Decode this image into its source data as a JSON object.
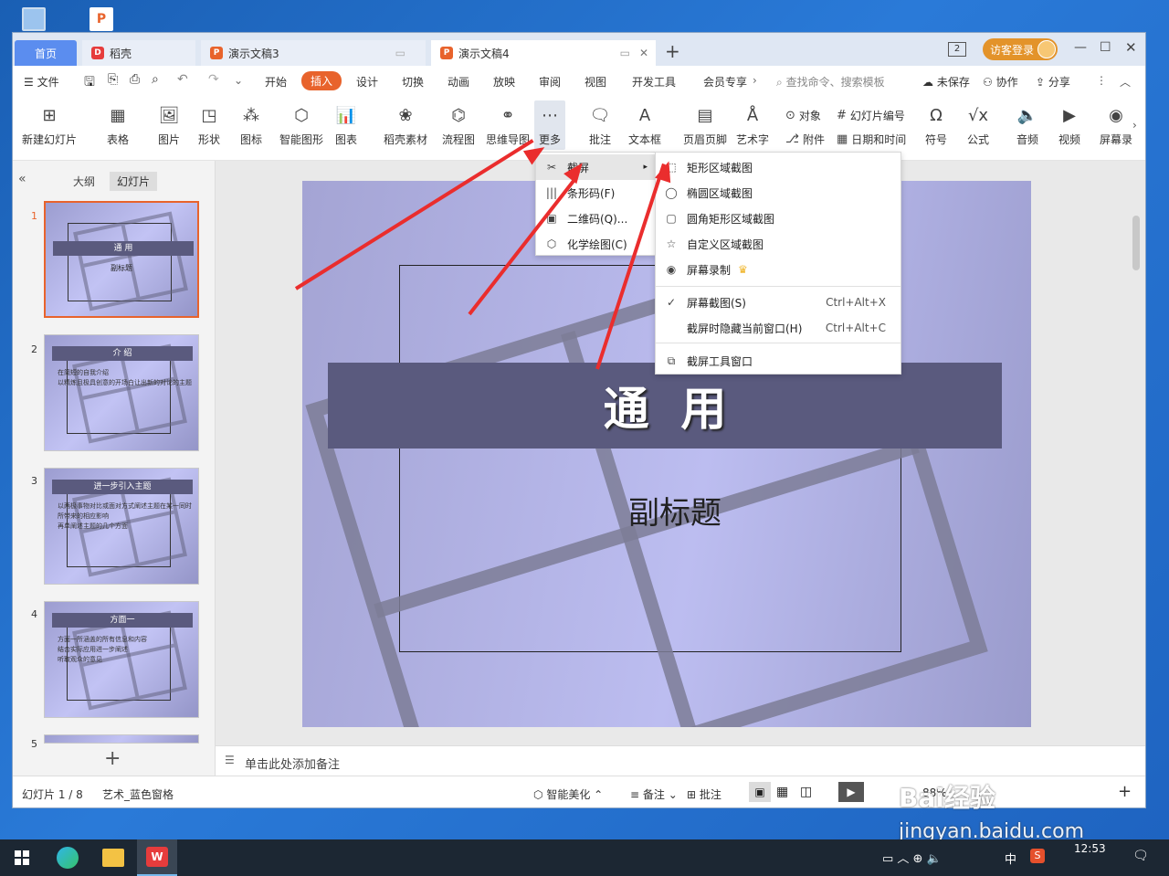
{
  "window": {
    "tabs": [
      {
        "label": "首页"
      },
      {
        "label": "稻壳"
      },
      {
        "label": "演示文稿3"
      },
      {
        "label": "演示文稿4"
      }
    ],
    "page_badge": "2",
    "login": "访客登录"
  },
  "menu": {
    "file": "文件",
    "items": [
      "开始",
      "插入",
      "设计",
      "切换",
      "动画",
      "放映",
      "审阅",
      "视图",
      "开发工具",
      "会员专享"
    ],
    "search_placeholder": "查找命令、搜索模板",
    "unsaved": "未保存",
    "collab": "协作",
    "share": "分享"
  },
  "ribbon": {
    "new_slide": "新建幻灯片",
    "table": "表格",
    "picture": "图片",
    "shape": "形状",
    "icon": "图标",
    "smart_shape": "智能图形",
    "chart": "图表",
    "dk_material": "稻壳素材",
    "flowchart": "流程图",
    "mindmap": "思维导图",
    "more": "更多",
    "comment": "批注",
    "textbox": "文本框",
    "header_footer": "页眉页脚",
    "wordart": "艺术字",
    "object": "对象",
    "attachment": "附件",
    "slide_number": "幻灯片编号",
    "datetime": "日期和时间",
    "symbol": "符号",
    "formula": "公式",
    "audio": "音频",
    "video": "视频",
    "screen_rec": "屏幕录"
  },
  "panel": {
    "outline_tab": "大纲",
    "slides_tab": "幻灯片",
    "slides": [
      {
        "num": "1",
        "title": "通  用",
        "sub": "副标题",
        "bullets": []
      },
      {
        "num": "2",
        "title": "介  绍",
        "bullets": [
          "在简短的自我介绍",
          "以精炼且极具创意的开场白让出新的对论的主题"
        ]
      },
      {
        "num": "3",
        "title": "进一步引入主题",
        "bullets": [
          "以两极事物对比或面对方式阐述主题在某一同时所带来的相应影响",
          "再单阐述主题的几个方面"
        ]
      },
      {
        "num": "4",
        "title": "方面一",
        "bullets": [
          "方面一所涵盖的所有信息和内容",
          "结合实际应用进一步阐述",
          "听取观众的意见"
        ]
      },
      {
        "num": "5"
      }
    ]
  },
  "slide": {
    "title": "通  用",
    "subtitle": "副标题"
  },
  "notes_placeholder": "单击此处添加备注",
  "status": {
    "slide_count": "幻灯片 1 / 8",
    "theme": "艺术_蓝色窗格",
    "beautify": "智能美化",
    "notes": "备注",
    "comment": "批注",
    "zoom": "88%"
  },
  "more_menu": [
    {
      "icon": "scissors-icon",
      "label": "截屏"
    },
    {
      "icon": "barcode-icon",
      "label": "条形码(F)"
    },
    {
      "icon": "qrcode-icon",
      "label": "二维码(Q)..."
    },
    {
      "icon": "chem-icon",
      "label": "化学绘图(C)"
    }
  ],
  "screenshot_menu": [
    {
      "label": "矩形区域截图"
    },
    {
      "label": "椭圆区域截图"
    },
    {
      "label": "圆角矩形区域截图"
    },
    {
      "label": "自定义区域截图"
    },
    {
      "label": "屏幕录制"
    },
    {
      "label": "屏幕截图(S)",
      "shortcut": "Ctrl+Alt+X",
      "checked": true
    },
    {
      "label": "截屏时隐藏当前窗口(H)",
      "shortcut": "Ctrl+Alt+C"
    },
    {
      "label": "截屏工具窗口"
    }
  ],
  "taskbar": {
    "time": "12:53",
    "ime": "中"
  },
  "watermark": {
    "brand": "Bai经验",
    "url": "jingyan.baidu.com"
  },
  "colors": {
    "accent": "#e8632c",
    "tab_active": "#5b8def",
    "arrow": "#ea2d2d",
    "slide_band": "#5a5a7e"
  }
}
